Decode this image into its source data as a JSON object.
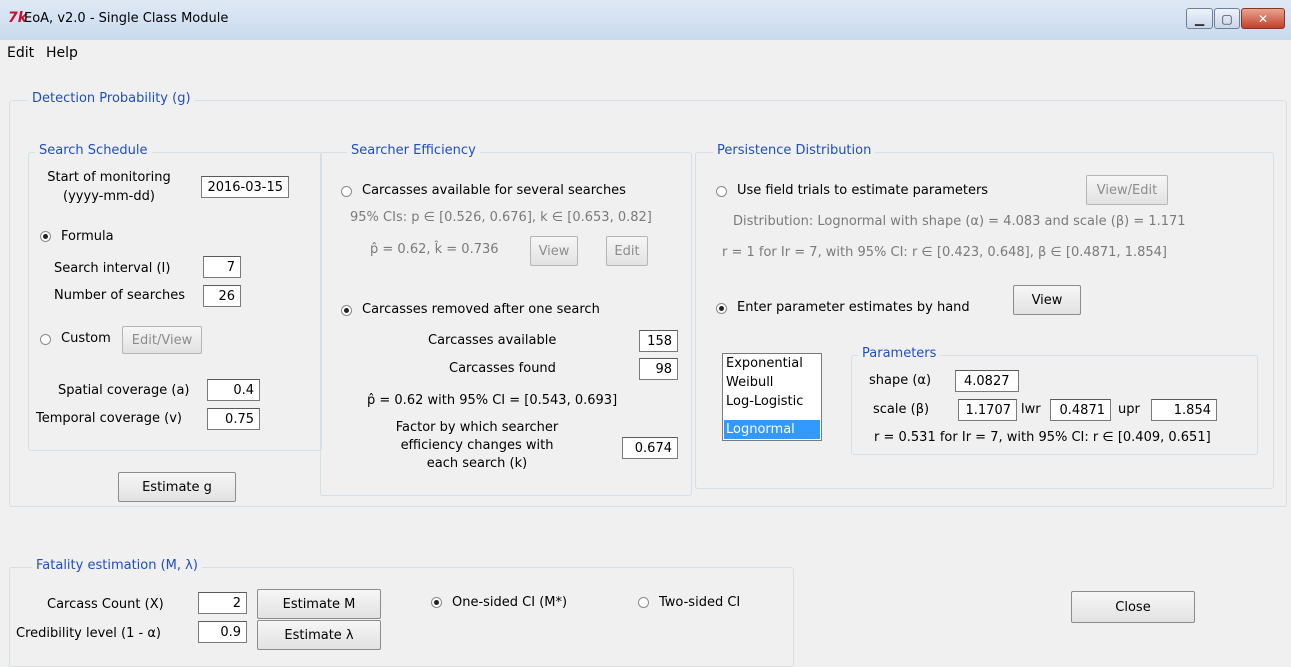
{
  "window": {
    "icon_text": "7k",
    "title": "EoA, v2.0 - Single Class Module",
    "min_label": "▁",
    "max_label": "▢",
    "close_label": "✕"
  },
  "menu": [
    "Edit",
    "Help"
  ],
  "detection": {
    "legend": "Detection Probability (g)",
    "schedule": {
      "legend": "Search Schedule",
      "start_label_1": "Start of monitoring",
      "start_label_2": "(yyyy-mm-dd)",
      "start_value": "2016-03-15",
      "formula_label": "Formula",
      "formula_selected": true,
      "interval_label": "Search interval (I)",
      "interval_value": "7",
      "num_searches_label": "Number of searches",
      "num_searches_value": "26",
      "custom_label": "Custom",
      "edit_view_label": "Edit/View",
      "spatial_label": "Spatial coverage (a)",
      "spatial_value": "0.4",
      "temporal_label": "Temporal coverage (v)",
      "temporal_value": "0.75"
    },
    "estimate_g_label": "Estimate g",
    "searcher": {
      "legend": "Searcher Efficiency",
      "option1_label": "Carcasses available for several searches",
      "ci_text": "95% CIs: p ∈ [0.526, 0.676], k ∈ [0.653, 0.82]",
      "est_text": "p̂ = 0.62, k̂ = 0.736",
      "view_label": "View",
      "edit_label": "Edit",
      "option2_label": "Carcasses removed after one search",
      "available_label": "Carcasses available",
      "available_value": "158",
      "found_label": "Carcasses found",
      "found_value": "98",
      "p_ci_text": "p̂ = 0.62 with 95% CI = [0.543, 0.693]",
      "factor_label_1": "Factor by which searcher",
      "factor_label_2": "efficiency changes with",
      "factor_label_3": "each search (k)",
      "factor_value": "0.674"
    },
    "persistence": {
      "legend": "Persistence Distribution",
      "option1_label": "Use field trials to estimate parameters",
      "view_edit_label": "View/Edit",
      "dist_text": "Distribution: Lognormal with shape (α) = 4.083 and scale (β) = 1.171",
      "r_text": "r = 1 for Ir = 7, with 95% CI: r ∈ [0.423, 0.648], β ∈ [0.4871, 1.854]",
      "option2_label": "Enter parameter estimates by hand",
      "view_label": "View",
      "distributions": [
        "Exponential",
        "Weibull",
        "Log-Logistic",
        "Lognormal"
      ],
      "selected_distribution": "Lognormal",
      "params_legend": "Parameters",
      "shape_label": "shape (α)",
      "shape_value": "4.0827",
      "scale_label": "scale (β)",
      "scale_value": "1.1707",
      "lwr_label": "lwr",
      "lwr_value": "0.4871",
      "upr_label": "upr",
      "upr_value": "1.854",
      "r_hand_text": "r = 0.531 for Ir = 7, with 95% CI: r ∈ [0.409, 0.651]"
    }
  },
  "fatality": {
    "legend": "Fatality estimation (M, λ)",
    "count_label": "Carcass Count (X)",
    "count_value": "2",
    "cred_label": "Credibility level (1 - α)",
    "cred_value": "0.9",
    "estimate_m_label": "Estimate M",
    "estimate_lambda_label": "Estimate λ",
    "one_sided_label": "One-sided CI (M*)",
    "two_sided_label": "Two-sided CI"
  },
  "close_label": "Close"
}
